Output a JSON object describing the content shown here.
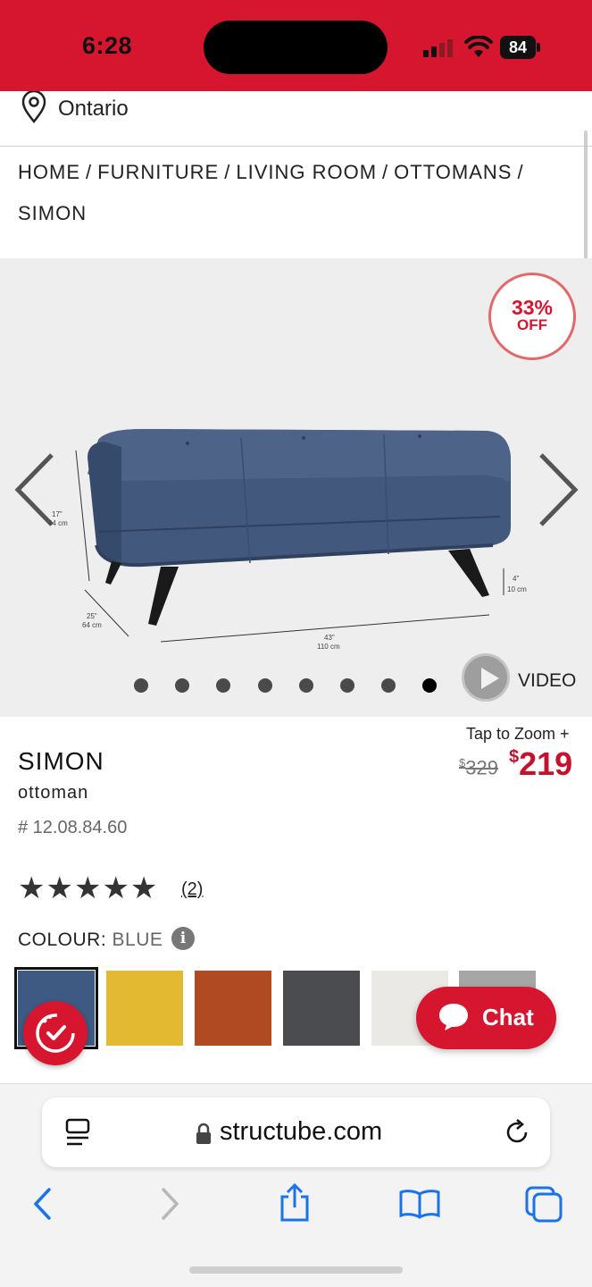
{
  "status_bar": {
    "time": "6:28",
    "battery": "84"
  },
  "location": {
    "label": "Ontario"
  },
  "breadcrumb": {
    "items": [
      "HOME",
      "FURNITURE",
      "LIVING ROOM",
      "OTTOMANS",
      "SIMON"
    ],
    "separator": "/"
  },
  "gallery": {
    "badge_percent": "33%",
    "badge_off": "OFF",
    "dot_count": 8,
    "active_dot": 8,
    "video_label": "VIDEO",
    "dimensions": {
      "height": "17\"",
      "height_cm": "44 cm",
      "depth": "25\"",
      "depth_cm": "64 cm",
      "width": "43\"",
      "width_cm": "110 cm",
      "leg": "4\"",
      "leg_cm": "10 cm"
    }
  },
  "product": {
    "tap_zoom": "Tap to Zoom +",
    "name": "SIMON",
    "type": "ottoman",
    "sku": "# 12.08.84.60",
    "old_price_symbol": "$",
    "old_price": "329",
    "new_price_symbol": "$",
    "new_price": "219",
    "stars": "★★★★★",
    "rating": 5,
    "review_count": "(2)",
    "colour_label": "COLOUR:",
    "colour_value": "BLUE",
    "info_icon": "i",
    "swatches": [
      {
        "name": "blue",
        "color": "#3f5a82"
      },
      {
        "name": "yellow",
        "color": "#e3b931"
      },
      {
        "name": "rust",
        "color": "#b04a22"
      },
      {
        "name": "charcoal",
        "color": "#4a4c4f"
      },
      {
        "name": "white",
        "color": "#ebe9e6"
      },
      {
        "name": "grey",
        "color": "#a6a6a6"
      }
    ]
  },
  "chat": {
    "label": "Chat"
  },
  "browser": {
    "url": "structube.com"
  },
  "colors": {
    "brand_red": "#d6162e",
    "price_red": "#c4122e"
  }
}
